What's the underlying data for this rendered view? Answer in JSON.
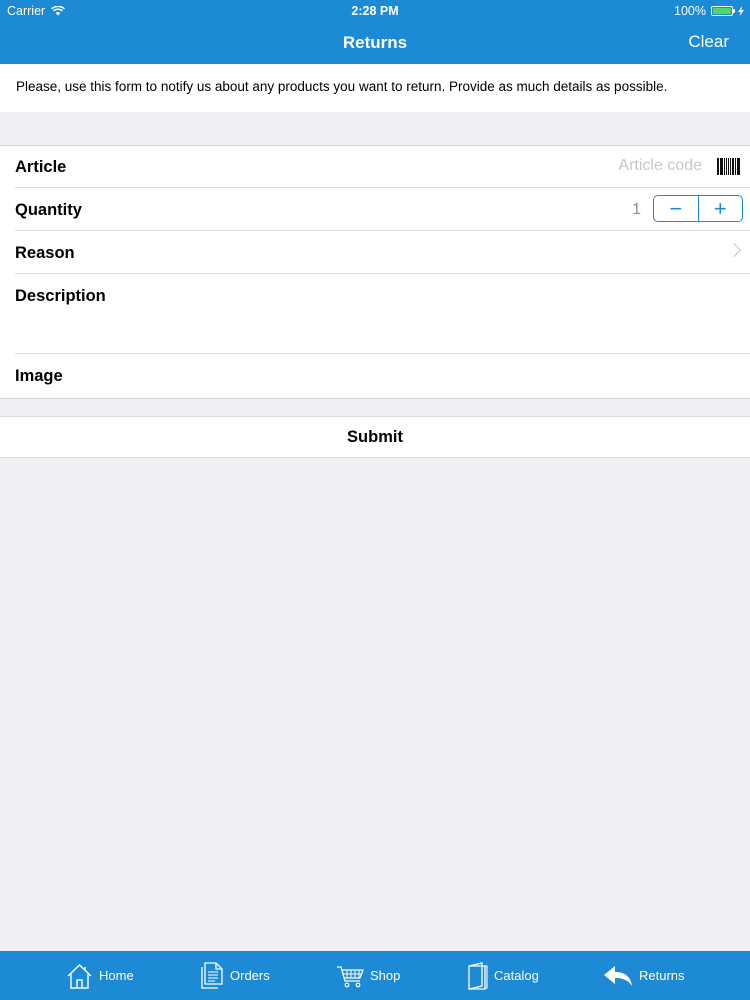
{
  "status_bar": {
    "carrier": "Carrier",
    "time": "2:28 PM",
    "battery": "100%"
  },
  "nav": {
    "title": "Returns",
    "clear_label": "Clear"
  },
  "intro_text": "Please, use this form to notify us about any products you want to return. Provide as much details as possible.",
  "form": {
    "article": {
      "label": "Article",
      "placeholder": "Article code"
    },
    "quantity": {
      "label": "Quantity",
      "value": "1",
      "minus": "−",
      "plus": "+"
    },
    "reason": {
      "label": "Reason"
    },
    "description": {
      "label": "Description"
    },
    "image": {
      "label": "Image"
    }
  },
  "submit_label": "Submit",
  "tabs": [
    {
      "label": "Home",
      "icon": "home-icon"
    },
    {
      "label": "Orders",
      "icon": "orders-icon"
    },
    {
      "label": "Shop",
      "icon": "cart-icon"
    },
    {
      "label": "Catalog",
      "icon": "catalog-icon"
    },
    {
      "label": "Returns",
      "icon": "return-arrow-icon"
    }
  ],
  "colors": {
    "accent": "#1c8ad4",
    "background": "#efeff4",
    "placeholder": "#c7c7cd"
  }
}
